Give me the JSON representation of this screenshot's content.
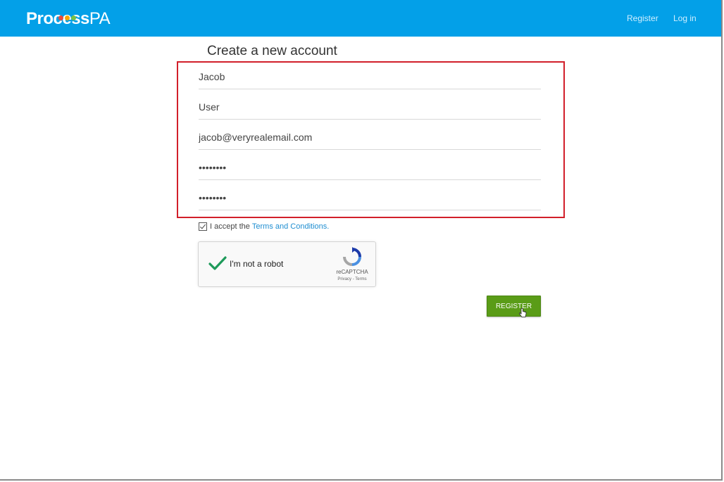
{
  "header": {
    "logo_text_bold": "Process",
    "logo_text_light": "PA",
    "logo_dot_colors": [
      "#e94b3c",
      "#f7a600",
      "#7ac143"
    ],
    "nav": {
      "register_label": "Register",
      "login_label": "Log in"
    }
  },
  "form": {
    "title": "Create a new account",
    "fields": [
      {
        "name": "first-name",
        "value": "Jacob",
        "type": "text"
      },
      {
        "name": "last-name",
        "value": "User",
        "type": "text"
      },
      {
        "name": "email",
        "value": "jacob@veryrealemail.com",
        "type": "text"
      },
      {
        "name": "password",
        "value": "••••••••",
        "type": "password"
      },
      {
        "name": "confirm-password",
        "value": "••••••••",
        "type": "password"
      }
    ],
    "terms": {
      "checked": true,
      "prefix": "I accept the",
      "link_text": "Terms and Conditions."
    },
    "captcha": {
      "label": "I'm not a robot",
      "brand": "reCAPTCHA",
      "links": "Privacy - Terms",
      "checked": true
    },
    "submit_label": "REGISTER"
  },
  "colors": {
    "header_bg": "#03a0e8",
    "highlight_border": "#d21f2a",
    "link": "#1f8ed1",
    "button_bg": "#5a9c17",
    "captcha_check": "#1e9a5a"
  }
}
